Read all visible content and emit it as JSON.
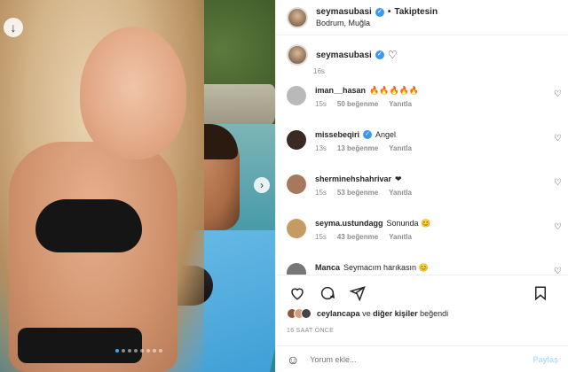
{
  "header": {
    "username": "seymasubasi",
    "separator": "•",
    "follow_label": "Takiptesin",
    "location": "Bodrum, Muğla"
  },
  "caption": {
    "username": "seymasubasi",
    "time": "16s"
  },
  "comments": [
    {
      "user": "iman__hasan",
      "text": "🔥🔥🔥🔥🔥",
      "time": "15s",
      "likes": "50 beğenme",
      "reply": "Yanıtla",
      "verified": false,
      "avatar_color": "#b9b9b9"
    },
    {
      "user": "missebeqiri",
      "text": "Angel",
      "time": "13s",
      "likes": "13 beğenme",
      "reply": "Yanıtla",
      "verified": true,
      "avatar_color": "#3a2a22"
    },
    {
      "user": "sherminehshahrivar",
      "text": "❤",
      "time": "15s",
      "likes": "53 beğenme",
      "reply": "Yanıtla",
      "verified": false,
      "avatar_color": "#a8785c"
    },
    {
      "user": "seyma.ustundagg",
      "text": "Sonunda 😊",
      "time": "15s",
      "likes": "43 beğenme",
      "reply": "Yanıtla",
      "verified": false,
      "avatar_color": "#c69a63"
    },
    {
      "user": "Manca",
      "text": "Seymacım harıkasın 😊",
      "time": "",
      "likes": "",
      "reply": "",
      "verified": false,
      "avatar_color": "#777"
    }
  ],
  "likes": {
    "liker": "ceylancapa",
    "connector": "ve",
    "others": "diğer kişiler",
    "verb": "beğendi"
  },
  "post_time": "16 SAAT ÖNCE",
  "add_comment": {
    "placeholder": "Yorum ekle...",
    "post_label": "Paylaş"
  },
  "icons": {
    "heart": "heart-icon",
    "comment": "comment-icon",
    "share": "share-icon",
    "save": "bookmark-icon",
    "emoji": "emoji-icon"
  },
  "colors": {
    "accent": "#3897f0",
    "post_disabled": "#b2dffc",
    "muted": "#8e8e8e"
  }
}
